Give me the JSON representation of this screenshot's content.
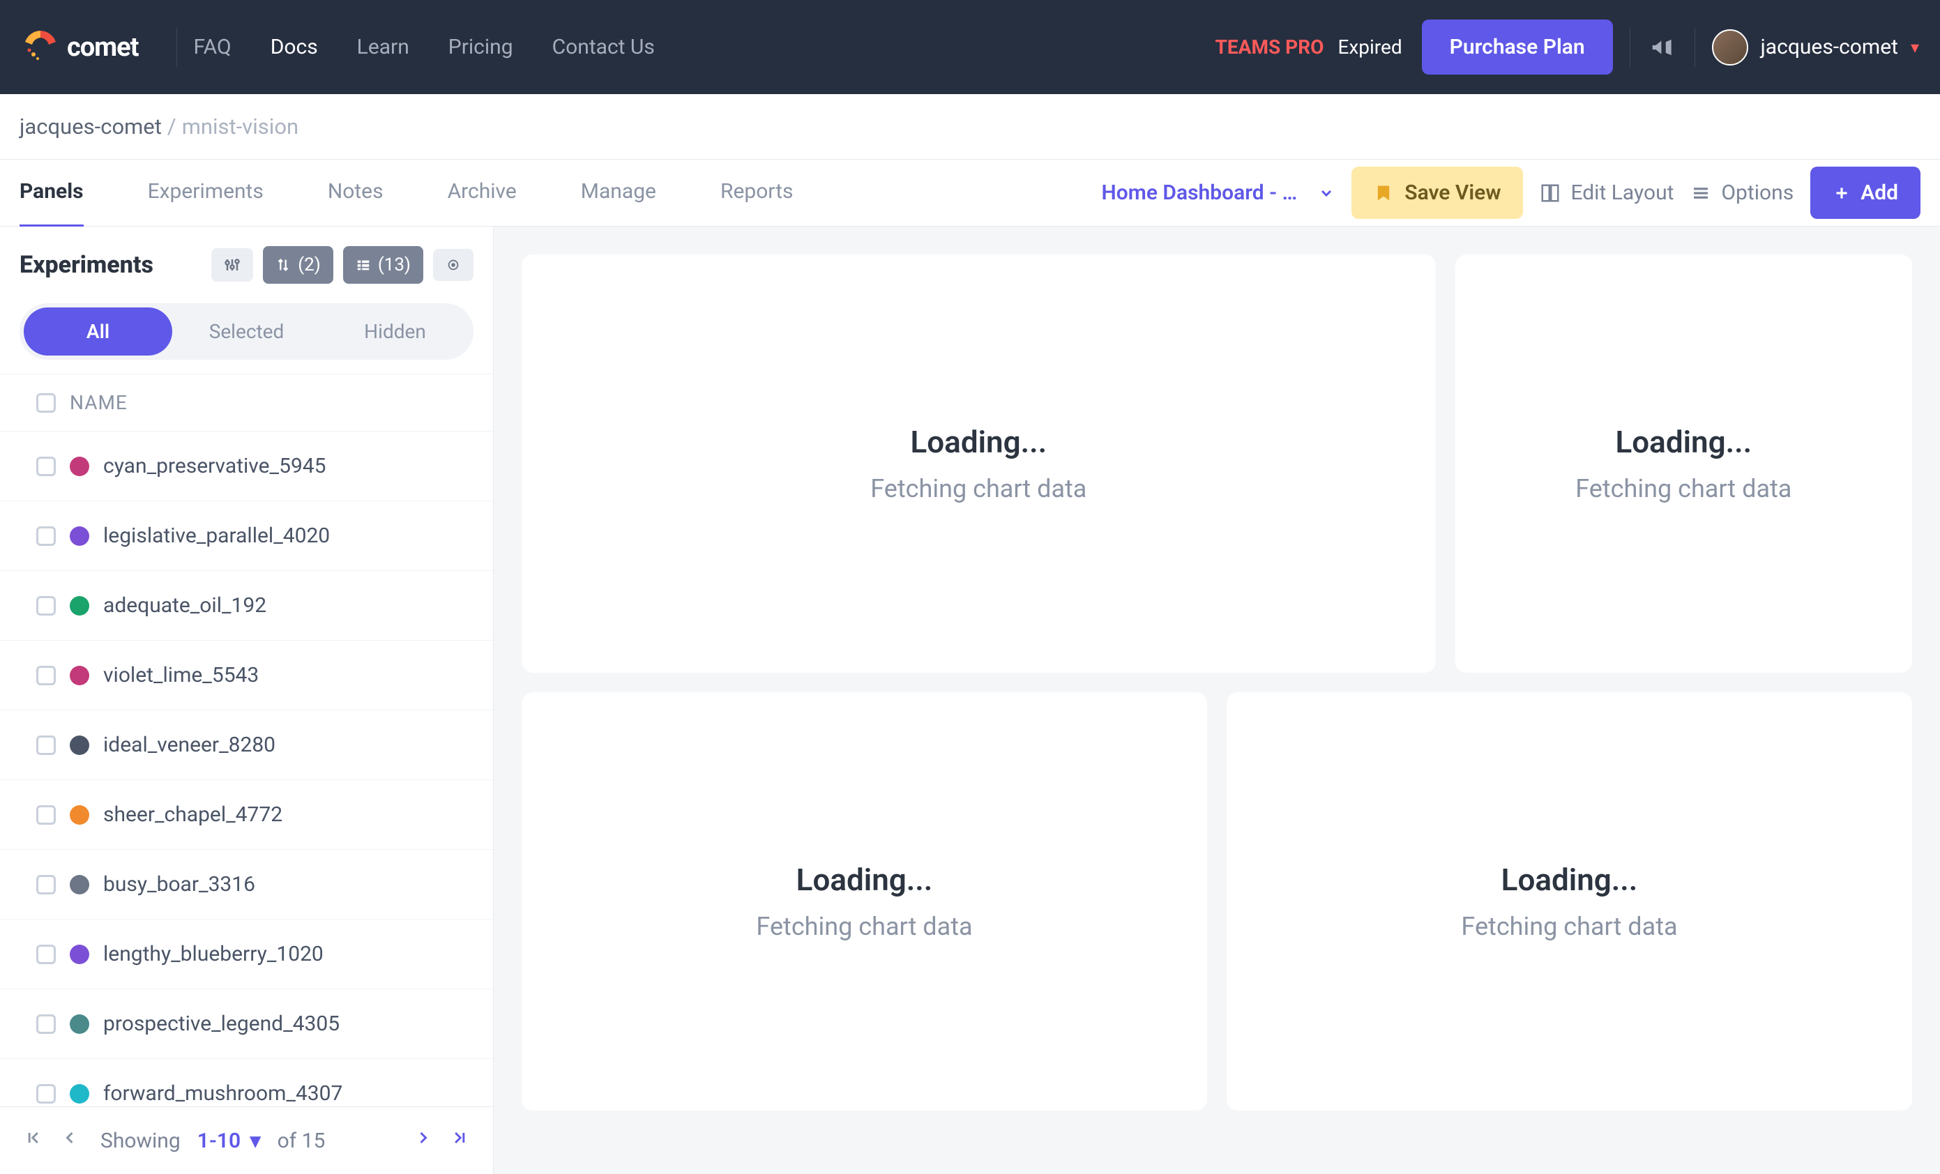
{
  "header": {
    "logo_text": "comet",
    "nav": [
      "FAQ",
      "Docs",
      "Learn",
      "Pricing",
      "Contact Us"
    ],
    "teams_pro": "TEAMS PRO",
    "expired": "Expired",
    "purchase": "Purchase Plan",
    "username": "jacques-comet"
  },
  "breadcrumb": {
    "user": "jacques-comet",
    "sep": "/",
    "project": "mnist-vision"
  },
  "subnav": {
    "tabs": [
      "Panels",
      "Experiments",
      "Notes",
      "Archive",
      "Manage",
      "Reports"
    ],
    "dashboard": "Home Dashboard - …",
    "save_view": "Save View",
    "edit_layout": "Edit Layout",
    "options": "Options",
    "add": "Add"
  },
  "sidebar": {
    "title": "Experiments",
    "chip_sort_count": "(2)",
    "chip_cols_count": "(13)",
    "seg": {
      "all": "All",
      "selected": "Selected",
      "hidden": "Hidden"
    },
    "name_header": "NAME",
    "rows": [
      {
        "color": "#c33a7a",
        "name": "cyan_preservative_5945"
      },
      {
        "color": "#7b4fd6",
        "name": "legislative_parallel_4020"
      },
      {
        "color": "#1aa36b",
        "name": "adequate_oil_192"
      },
      {
        "color": "#c33a7a",
        "name": "violet_lime_5543"
      },
      {
        "color": "#4a5466",
        "name": "ideal_veneer_8280"
      },
      {
        "color": "#f08a2d",
        "name": "sheer_chapel_4772"
      },
      {
        "color": "#6d7686",
        "name": "busy_boar_3316"
      },
      {
        "color": "#7b4fd6",
        "name": "lengthy_blueberry_1020"
      },
      {
        "color": "#4a8a8a",
        "name": "prospective_legend_4305"
      },
      {
        "color": "#1fb8c9",
        "name": "forward_mushroom_4307"
      }
    ],
    "pager": {
      "showing": "Showing",
      "range": "1-10",
      "of": "of 15"
    }
  },
  "panels": {
    "loading": "Loading...",
    "fetching": "Fetching chart data"
  }
}
